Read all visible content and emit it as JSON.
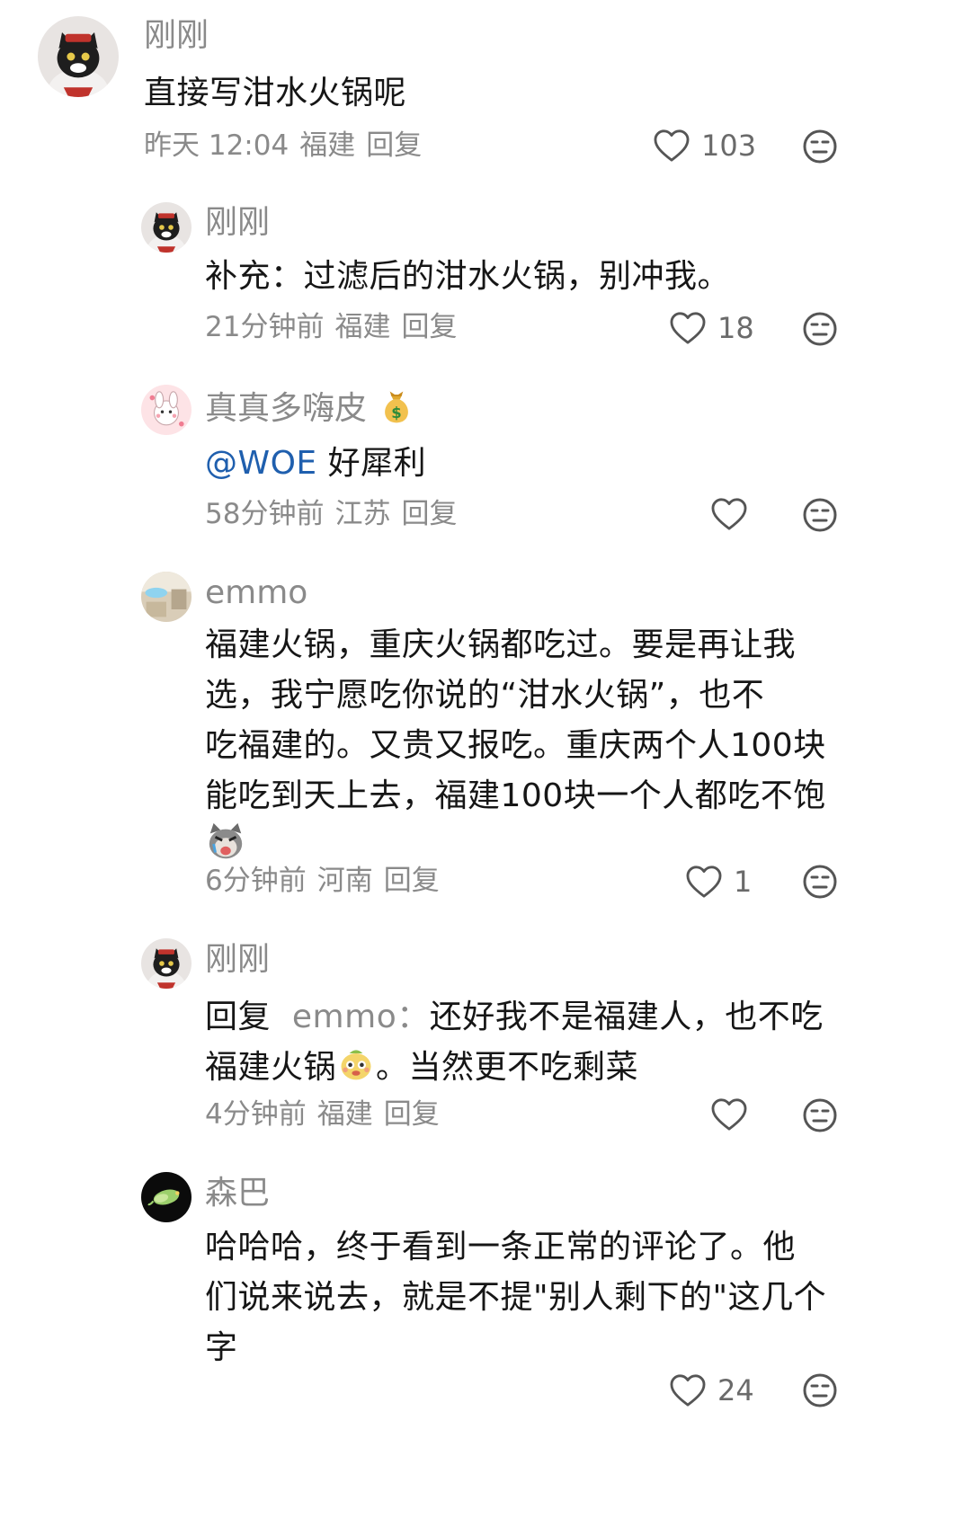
{
  "comments": [
    {
      "username": "刚刚",
      "lines": [
        "直接写泔水火锅呢"
      ],
      "time": "昨天 12:04",
      "location": "福建",
      "reply_label": "回复",
      "likes": "103",
      "avatar": "cat-avatar"
    },
    {
      "username": "刚刚",
      "lines": [
        "补充：过滤后的泔水火锅，别冲我。"
      ],
      "time": "21分钟前",
      "location": "福建",
      "reply_label": "回复",
      "likes": "18",
      "avatar": "cat-avatar"
    },
    {
      "username": "真真多嗨皮",
      "username_emoji": "money-bag-emoji",
      "mention": "@WOE",
      "text_after_mention": "好犀利",
      "time": "58分钟前",
      "location": "江苏",
      "reply_label": "回复",
      "likes": "",
      "avatar": "pink-bunny-avatar"
    },
    {
      "username": "emmo",
      "lines": [
        "福建火锅，重庆火锅都吃过。要是再让我",
        "选，我宁愿吃你说的“泔水火锅”，也不",
        "吃福建的。又贵又报吃。重庆两个人100块",
        "能吃到天上去，福建100块一个人都吃不饱"
      ],
      "trailing_emoji": "crying-cat-emoji",
      "time": "6分钟前",
      "location": "河南",
      "reply_label": "回复",
      "likes": "1",
      "avatar": "blue-room-avatar"
    },
    {
      "username": "刚刚",
      "reply_prefix": "回复",
      "reply_to": "emmo",
      "reply_colon": "：",
      "line1_text": "还好我不是福建人，也不吃",
      "line2_before": "福建火锅",
      "line2_emoji": "yellow-face-emoji",
      "line2_after": "。当然更不吃剩菜",
      "time": "4分钟前",
      "location": "福建",
      "reply_label": "回复",
      "likes": "",
      "avatar": "cat-avatar"
    },
    {
      "username": "森巴",
      "lines": [
        "哈哈哈，终于看到一条正常的评论了。他",
        "们说来说去，就是不提\"别人剩下的\"这几个",
        "字"
      ],
      "time": "",
      "location": "",
      "reply_label": "",
      "likes": "24",
      "avatar": "green-bird-avatar"
    }
  ],
  "colors": {
    "text": "#161616",
    "meta": "#8a8a8a",
    "mention": "#1f5fae",
    "background": "#ffffff"
  }
}
